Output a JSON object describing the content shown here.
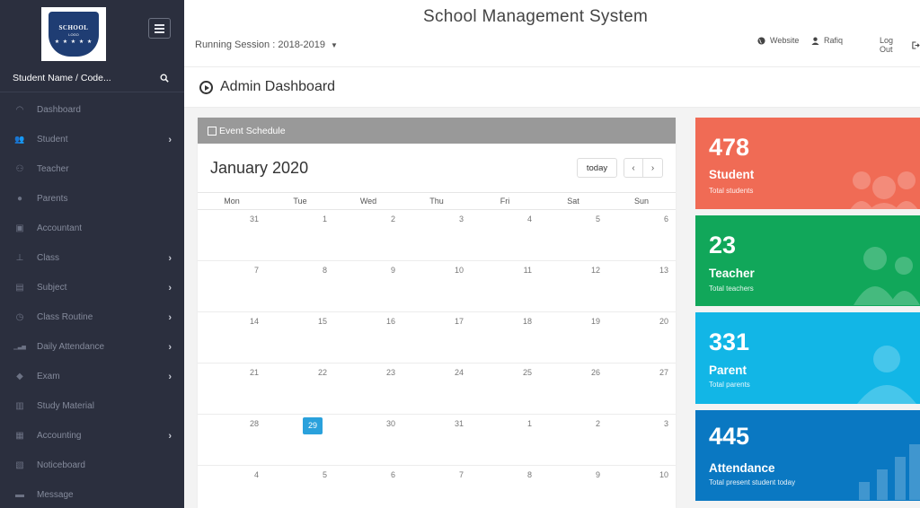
{
  "app": {
    "title": "School Management System"
  },
  "logo": {
    "line1": "SCHOOL",
    "line2": "LOGO",
    "stars": "★ ★ ★ ★ ★"
  },
  "sidebar": {
    "search_placeholder": "Student Name / Code...",
    "items": [
      {
        "label": "Dashboard",
        "icon": "dashboard-icon",
        "chevron": false
      },
      {
        "label": "Student",
        "icon": "users-icon",
        "chevron": true
      },
      {
        "label": "Teacher",
        "icon": "teacher-icon",
        "chevron": false
      },
      {
        "label": "Parents",
        "icon": "user-icon",
        "chevron": false
      },
      {
        "label": "Accountant",
        "icon": "briefcase-icon",
        "chevron": false
      },
      {
        "label": "Class",
        "icon": "sitemap-icon",
        "chevron": true
      },
      {
        "label": "Subject",
        "icon": "book-icon",
        "chevron": true
      },
      {
        "label": "Class Routine",
        "icon": "clock-icon",
        "chevron": true
      },
      {
        "label": "Daily Attendance",
        "icon": "signal-icon",
        "chevron": true
      },
      {
        "label": "Exam",
        "icon": "graduation-cap-icon",
        "chevron": true
      },
      {
        "label": "Study Material",
        "icon": "book-open-icon",
        "chevron": false
      },
      {
        "label": "Accounting",
        "icon": "calculator-icon",
        "chevron": true
      },
      {
        "label": "Noticeboard",
        "icon": "clipboard-icon",
        "chevron": false
      },
      {
        "label": "Message",
        "icon": "inbox-icon",
        "chevron": false
      }
    ]
  },
  "header": {
    "session_label": "Running Session : 2018-2019",
    "website_label": "Website",
    "user_label": "Rafiq",
    "logout_label": "Log Out"
  },
  "dashboard": {
    "title": "Admin Dashboard"
  },
  "calendar": {
    "panel_title": "Event Schedule",
    "month": "January 2020",
    "today_label": "today",
    "prev_label": "‹",
    "next_label": "›",
    "days_of_week": [
      "Mon",
      "Tue",
      "Wed",
      "Thu",
      "Fri",
      "Sat",
      "Sun"
    ],
    "weeks": [
      [
        "31",
        "1",
        "2",
        "3",
        "4",
        "5",
        "6"
      ],
      [
        "7",
        "8",
        "9",
        "10",
        "11",
        "12",
        "13"
      ],
      [
        "14",
        "15",
        "16",
        "17",
        "18",
        "19",
        "20"
      ],
      [
        "21",
        "22",
        "23",
        "24",
        "25",
        "26",
        "27"
      ],
      [
        "28",
        "29",
        "30",
        "31",
        "1",
        "2",
        "3"
      ],
      [
        "4",
        "5",
        "6",
        "7",
        "8",
        "9",
        "10"
      ]
    ],
    "today_date": "29"
  },
  "stats": [
    {
      "value": "478",
      "label": "Student",
      "sub": "Total students",
      "color": "#f06b55",
      "icon": "users-icon"
    },
    {
      "value": "23",
      "label": "Teacher",
      "sub": "Total teachers",
      "color": "#11a75a",
      "icon": "user-group-icon"
    },
    {
      "value": "331",
      "label": "Parent",
      "sub": "Total parents",
      "color": "#12b6e6",
      "icon": "user-icon"
    },
    {
      "value": "445",
      "label": "Attendance",
      "sub": "Total present student today",
      "color": "#0a78c2",
      "icon": "bar-chart-icon"
    }
  ]
}
